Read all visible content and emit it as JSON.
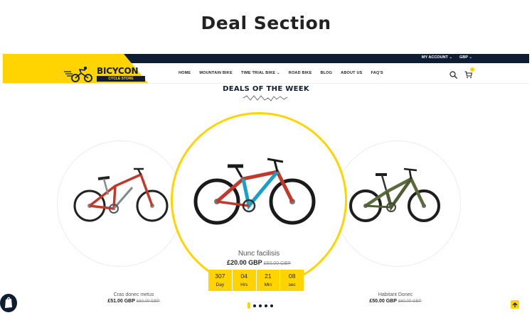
{
  "page": {
    "heading": "Deal Section"
  },
  "topbar": {
    "account": "MY ACCOUNT ⌄",
    "currency": "GBP ⌄"
  },
  "logo": {
    "brand": "BICYCON",
    "tagline": "CYCLE STORE"
  },
  "nav": {
    "items": [
      "HOME",
      "MOUNTAIN BIKE",
      "TIME TRIAL BIKE ⌄",
      "ROAD BIKE",
      "BLOG",
      "ABOUT US",
      "FAQ'S"
    ],
    "search_icon": "search-icon",
    "cart_icon": "cart-icon"
  },
  "section": {
    "title": "DEALS OF THE WEEK"
  },
  "products": [
    {
      "name": "Cras donec metus",
      "price": "£51.00 GBP",
      "old_price": "£60.00 GBP"
    },
    {
      "name": "Nunc facilisis",
      "price": "£20.00 GBP",
      "old_price": "£50.00 GBP"
    },
    {
      "name": "Habitant Donec",
      "price": "£50.00 GBP",
      "old_price": "£60.00 GBP"
    }
  ],
  "countdown": [
    {
      "value": "307",
      "label": "Day"
    },
    {
      "value": "04",
      "label": "Hrs"
    },
    {
      "value": "21",
      "label": "Min"
    },
    {
      "value": "08",
      "label": "sec"
    }
  ],
  "carousel": {
    "total_dots": 5,
    "active_index": 0
  },
  "colors": {
    "accent": "#ffd400",
    "navy": "#0f1d33"
  }
}
